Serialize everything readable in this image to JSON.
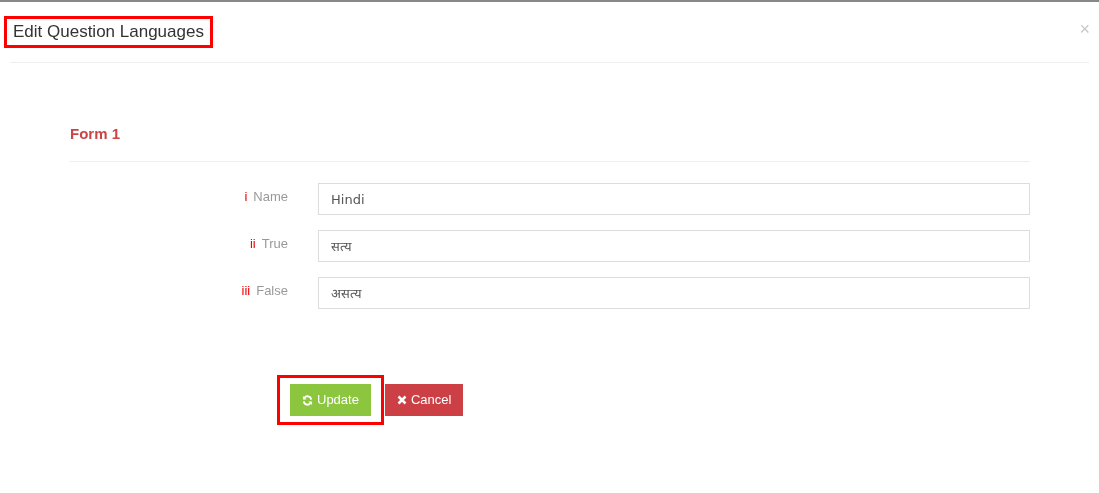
{
  "dialog": {
    "title": "Edit Question Languages",
    "title_highlighted": true,
    "close": "×"
  },
  "form": {
    "heading": "Form 1",
    "fields": [
      {
        "index": "i",
        "label": "Name",
        "value": "Hindi"
      },
      {
        "index": "ii",
        "label": "True",
        "value": "सत्य"
      },
      {
        "index": "iii",
        "label": "False",
        "value": "असत्य"
      }
    ]
  },
  "buttons": [
    {
      "kind": "update",
      "label": "Update",
      "highlighted": true
    },
    {
      "kind": "cancel",
      "label": "Cancel",
      "highlighted": false
    }
  ]
}
